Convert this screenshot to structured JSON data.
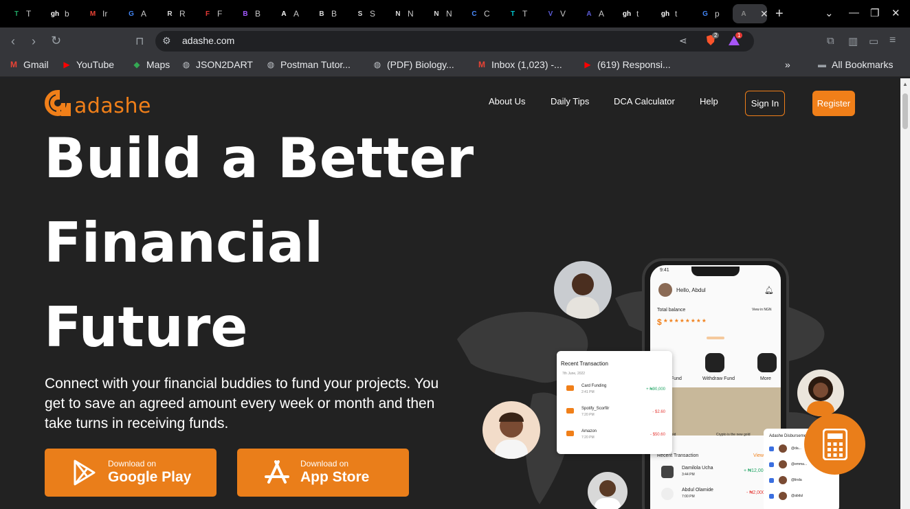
{
  "browser": {
    "tabs": [
      {
        "label": "T",
        "fav": "T",
        "color": "#1fa463"
      },
      {
        "label": "b",
        "fav": "gh",
        "color": "#ffffff"
      },
      {
        "label": "Ir",
        "fav": "M",
        "color": "#ea4335"
      },
      {
        "label": "A",
        "fav": "G",
        "color": "#4285f4"
      },
      {
        "label": "R",
        "fav": "R",
        "color": "#dddddd"
      },
      {
        "label": "F",
        "fav": "F",
        "color": "#e53935"
      },
      {
        "label": "B",
        "fav": "B",
        "color": "#a259ff"
      },
      {
        "label": "A",
        "fav": "A",
        "color": "#ffffff"
      },
      {
        "label": "B",
        "fav": "B",
        "color": "#dddddd"
      },
      {
        "label": "S",
        "fav": "S",
        "color": "#dddddd"
      },
      {
        "label": "N",
        "fav": "N",
        "color": "#dddddd"
      },
      {
        "label": "N",
        "fav": "N",
        "color": "#dddddd"
      },
      {
        "label": "C",
        "fav": "C",
        "color": "#4a8cff"
      },
      {
        "label": "T",
        "fav": "T",
        "color": "#00c4cc"
      },
      {
        "label": "V",
        "fav": "V",
        "color": "#5b5bd6"
      },
      {
        "label": "A",
        "fav": "A",
        "color": "#5b5bd6"
      },
      {
        "label": "t",
        "fav": "gh",
        "color": "#ffffff"
      },
      {
        "label": "t",
        "fav": "gh",
        "color": "#ffffff"
      },
      {
        "label": "p",
        "fav": "G",
        "color": "#4285f4"
      },
      {
        "label": "A",
        "fav": "A",
        "color": "#888888",
        "active": true
      }
    ],
    "url": "adashe.com",
    "brave_badge": "2",
    "alert_badge": "1",
    "bookmarks": [
      {
        "label": "Gmail",
        "icon": "gmail-icon",
        "color": "#ea4335",
        "glyph": "M"
      },
      {
        "label": "YouTube",
        "icon": "youtube-icon",
        "color": "#ff0000",
        "glyph": "▶"
      },
      {
        "label": "Maps",
        "icon": "maps-icon",
        "color": "#34a853",
        "glyph": "◆"
      },
      {
        "label": "JSON2DART",
        "icon": "globe-icon",
        "color": "#bdc1c6",
        "glyph": "◍"
      },
      {
        "label": "Postman Tutor...",
        "icon": "globe-icon",
        "color": "#bdc1c6",
        "glyph": "◍"
      },
      {
        "label": "(PDF) Biology...",
        "icon": "globe-icon",
        "color": "#bdc1c6",
        "glyph": "◍"
      },
      {
        "label": "Inbox (1,023) -...",
        "icon": "gmail-icon",
        "color": "#ea4335",
        "glyph": "M"
      },
      {
        "label": "(619) Responsi...",
        "icon": "youtube-icon",
        "color": "#ff0000",
        "glyph": "▶"
      }
    ],
    "all_bookmarks": "All Bookmarks",
    "overflow": "»"
  },
  "site": {
    "logo_text": "adashe",
    "nav": [
      "About Us",
      "Daily Tips",
      "DCA Calculator",
      "Help"
    ],
    "signin": "Sign In",
    "register": "Register",
    "hero": [
      "Build a Better",
      "Financial",
      "Future"
    ],
    "subtitle": "Connect with your financial buddies to fund your projects. You get to save an agreed amount every week or month and then take turns in receiving funds.",
    "store_buttons": [
      {
        "small": "Download on",
        "big": "Google Play",
        "icon": "google-play-icon"
      },
      {
        "small": "Download on",
        "big": "App Store",
        "icon": "app-store-icon"
      }
    ],
    "colors": {
      "accent": "#f07f19",
      "background": "#222222"
    }
  },
  "phone": {
    "time": "9:41",
    "greeting": "Hello, Abdul",
    "balance_label": "Total balance",
    "view_in": "View in NGN",
    "balance_masked": "$ * * * * * * * *",
    "actions": [
      "Fund",
      "Withdraw Fund",
      "More"
    ],
    "promo": [
      "is the new gold",
      "Crypto is the new gold"
    ],
    "recent_title": "Recent Transaction",
    "view_all": "View all",
    "transactions": [
      {
        "name": "Damilola Ucha",
        "time": "3:44 PM",
        "amount": "+ ₦12,000"
      },
      {
        "name": "Abdul Olamide",
        "time": "7:00 PM",
        "amount": "- ₦2,000"
      }
    ]
  },
  "recent_card": {
    "title": "Recent Transaction",
    "date": "7th June, 2022",
    "items": [
      {
        "name": "Card Funding",
        "time": "2:41 PM",
        "amount": "+ ₦90,000",
        "color": "#1fa463"
      },
      {
        "name": "Spotify_Scorfilr",
        "time": "7:20 PM",
        "amount": "- $2.60",
        "color": "#e53935"
      },
      {
        "name": "Amazon",
        "time": "7:20 PM",
        "amount": "- $50.60",
        "color": "#e53935"
      }
    ]
  },
  "disbursement_card": {
    "title": "Adashe Disburseme...",
    "rows": [
      "@da...",
      "@emma...",
      "@linda",
      "@abdul"
    ]
  }
}
